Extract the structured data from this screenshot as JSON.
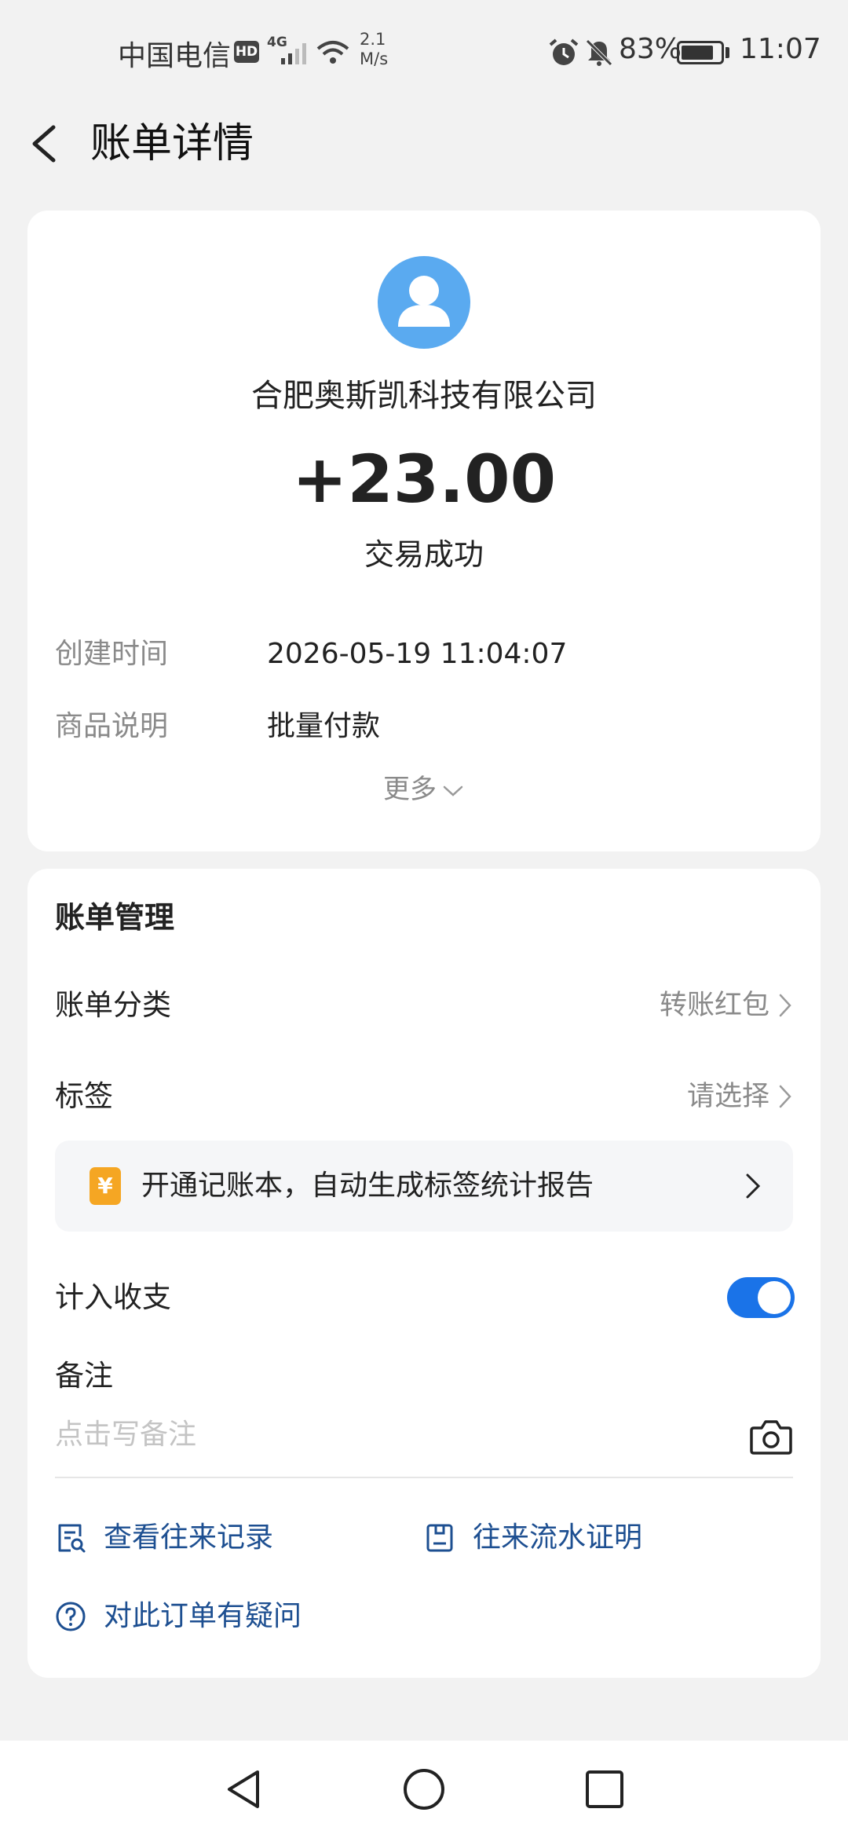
{
  "status_bar": {
    "carrier": "中国电信",
    "hd": "HD",
    "network": "4G",
    "speed_value": "2.1",
    "speed_unit": "M/s",
    "battery_percent": "83%",
    "battery_level": 0.83,
    "time": "11:07"
  },
  "header": {
    "title": "账单详情"
  },
  "transaction": {
    "merchant": "合肥奥斯凯科技有限公司",
    "amount": "+23.00",
    "status": "交易成功",
    "details": [
      {
        "label": "创建时间",
        "value": "2026-05-19 11:04:07"
      },
      {
        "label": "商品说明",
        "value": "批量付款"
      }
    ],
    "more_label": "更多"
  },
  "management": {
    "title": "账单管理",
    "category_label": "账单分类",
    "category_value": "转账红包",
    "tag_label": "标签",
    "tag_value": "请选择",
    "promo_icon": "¥",
    "promo_text": "开通记账本，自动生成标签统计报告",
    "include_label": "计入收支",
    "include_enabled": true,
    "note_label": "备注",
    "note_placeholder": "点击写备注",
    "links": {
      "history": "查看往来记录",
      "proof": "往来流水证明",
      "question": "对此订单有疑问"
    }
  },
  "colors": {
    "accent": "#1a73e8",
    "link": "#1d4f91",
    "avatar": "#5aaaf0",
    "promo_icon": "#f5a623"
  },
  "icons": {
    "back": "chevron-left-icon",
    "avatar": "user-icon",
    "camera": "camera-icon",
    "history": "receipt-search-icon",
    "proof": "document-icon",
    "question": "help-circle-icon"
  }
}
